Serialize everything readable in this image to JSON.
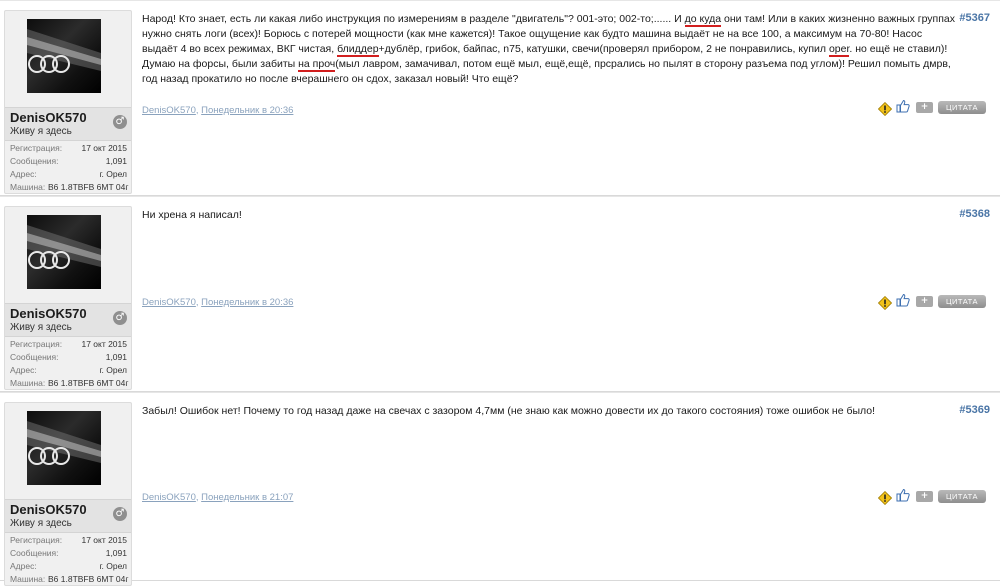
{
  "posts": [
    {
      "number": "#5367",
      "user": {
        "name": "DenisOK570",
        "status": "Живу я здесь",
        "gender_symbol": "♂",
        "info": [
          {
            "label": "Регистрация:",
            "value": "17 окт 2015"
          },
          {
            "label": "Сообщения:",
            "value": "1,091"
          },
          {
            "label": "Адрес:",
            "value": "г. Орел"
          },
          {
            "label": "Машина:",
            "value": "B6 1.8TBFB 6MT 04г"
          }
        ]
      },
      "text_parts": [
        {
          "t": "Народ! Кто знает, есть ли какая либо инструкция по измерениям в разделе \"двигатель\"? 001-это; 002-то;...... И "
        },
        {
          "t": "до куда",
          "u": true
        },
        {
          "t": " они там! Или в каких жизненно важных группах нужно снять логи (всех)! Борюсь с потерей мощности (как мне кажется)! Такое ощущение как будто машина выдаёт не на все 100, а максимум на 70-80! Насос выдаёт 4 во всех режимах, ВКГ чистая, "
        },
        {
          "t": "блиддер",
          "u": true
        },
        {
          "t": "+дублёр, грибок, байпас, n75, катушки, свечи(проверял прибором, 2 не понравились, купил "
        },
        {
          "t": "ореr",
          "u": true
        },
        {
          "t": ". но ещё не ставил)! Думаю на форсы, были забиты "
        },
        {
          "t": "на проч",
          "u": true
        },
        {
          "t": "(мыл лавром, замачивал, потом ещё мыл, ещё,ещё, прсрались но пылят в сторону разъема под углом)! Решил помыть дмрв, год назад прокатило но после вчерашнего он сдох, заказал новый! Что ещё?"
        }
      ],
      "author_link": "DenisOK570",
      "date_link": "Понедельник в 20:36",
      "quote_label": "ЦИТАТА",
      "multi_label": "+"
    },
    {
      "number": "#5368",
      "user": {
        "name": "DenisOK570",
        "status": "Живу я здесь",
        "gender_symbol": "♂",
        "info": [
          {
            "label": "Регистрация:",
            "value": "17 окт 2015"
          },
          {
            "label": "Сообщения:",
            "value": "1,091"
          },
          {
            "label": "Адрес:",
            "value": "г. Орел"
          },
          {
            "label": "Машина:",
            "value": "B6 1.8TBFB 6MT 04г"
          }
        ]
      },
      "text_parts": [
        {
          "t": "Ни хрена я написал!"
        }
      ],
      "author_link": "DenisOK570",
      "date_link": "Понедельник в 20:36",
      "quote_label": "ЦИТАТА",
      "multi_label": "+"
    },
    {
      "number": "#5369",
      "user": {
        "name": "DenisOK570",
        "status": "Живу я здесь",
        "gender_symbol": "♂",
        "info": [
          {
            "label": "Регистрация:",
            "value": "17 окт 2015"
          },
          {
            "label": "Сообщения:",
            "value": "1,091"
          },
          {
            "label": "Адрес:",
            "value": "г. Орел"
          },
          {
            "label": "Машина:",
            "value": "B6 1.8TBFB 6MT 04г"
          }
        ]
      },
      "text_parts": [
        {
          "t": "Забыл! Ошибок нет! Почему то год назад даже на свечах с зазором 4,7мм (не знаю как можно довести их до такого состояния) тоже ошибок не было!"
        }
      ],
      "author_link": "DenisOK570",
      "date_link": "Понедельник в 21:07",
      "quote_label": "ЦИТАТА",
      "multi_label": "+"
    }
  ],
  "colors": {
    "post_number": "#4a75a6",
    "meta_link": "#8aa2bd",
    "underline_mark": "#d21f1f",
    "userbox_bg": "#f0f0f0"
  },
  "icons": [
    "warning-icon",
    "like-icon",
    "multiquote-icon",
    "audi-rings-avatar",
    "male-gender-icon"
  ]
}
